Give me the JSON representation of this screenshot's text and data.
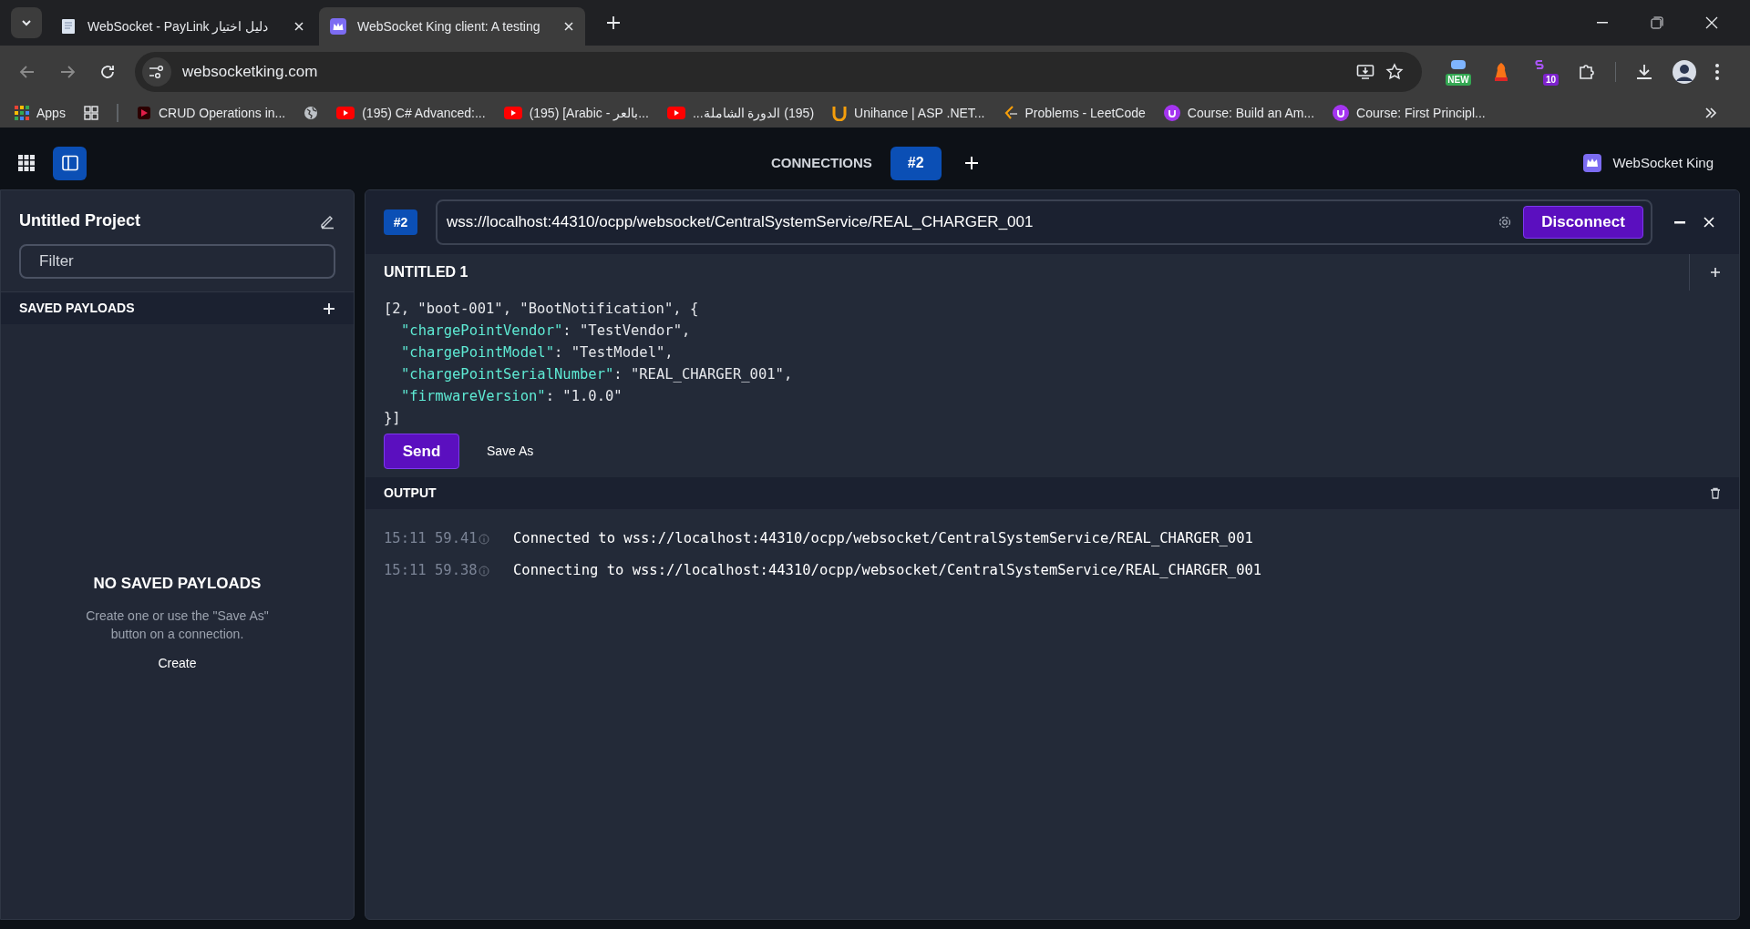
{
  "browser": {
    "tabs": [
      {
        "title": "WebSocket - PayLink دليل اختيار",
        "selected": false,
        "kind": "doc"
      },
      {
        "title": "WebSocket King client: A testing",
        "selected": true,
        "kind": "king"
      }
    ],
    "address": "websocketking.com",
    "bookmarks": [
      {
        "label": "Apps",
        "kind": "apps"
      },
      {
        "label": "CRUD Operations in...",
        "kind": "red"
      },
      {
        "kind": "globe"
      },
      {
        "label": "(195) C# Advanced:...",
        "kind": "youtube"
      },
      {
        "label": "(195) [Arabic - بالعر...",
        "kind": "youtube"
      },
      {
        "label": "(195) الدورة الشاملة...",
        "kind": "youtube"
      },
      {
        "label": "Unihance | ASP .NET...",
        "kind": "unihance"
      },
      {
        "label": "Problems - LeetCode",
        "kind": "leetcode"
      },
      {
        "label": "Course: Build an Am...",
        "kind": "udemy"
      },
      {
        "label": "Course: First Principl...",
        "kind": "udemy"
      }
    ],
    "extension_badges": [
      "NEW",
      "10"
    ]
  },
  "app": {
    "connections_label": "CONNECTIONS",
    "connection_tabs": [
      {
        "label": "#2",
        "selected": true
      }
    ],
    "brand": "WebSocket King"
  },
  "sidebar": {
    "project": "Untitled Project",
    "filter_placeholder": "Filter",
    "section": "SAVED PAYLOADS",
    "empty_title": "NO SAVED PAYLOADS",
    "empty_text": "Create one or use the \"Save As\" button on a connection.",
    "create": "Create"
  },
  "connection": {
    "badge": "#2",
    "url": "wss://localhost:44310/ocpp/websocket/CentralSystemService/REAL_CHARGER_001",
    "action": "Disconnect",
    "payload_title": "UNTITLED 1",
    "payload_lines": [
      {
        "text": "[2, \"boot-001\", \"BootNotification\", {"
      },
      {
        "key": "\"chargePointVendor\"",
        "text": ": \"TestVendor\","
      },
      {
        "key": "\"chargePointModel\"",
        "text": ": \"TestModel\","
      },
      {
        "key": "\"chargePointSerialNumber\"",
        "text": ": \"REAL_CHARGER_001\","
      },
      {
        "key": "\"firmwareVersion\"",
        "text": ": \"1.0.0\""
      },
      {
        "text": "}]"
      }
    ],
    "send": "Send",
    "save_as": "Save As",
    "output_title": "OUTPUT",
    "output": [
      {
        "time": "15:11 59.41",
        "message": "Connected to wss://localhost:44310/ocpp/websocket/CentralSystemService/REAL_CHARGER_001"
      },
      {
        "time": "15:11 59.38",
        "message": "Connecting to wss://localhost:44310/ocpp/websocket/CentralSystemService/REAL_CHARGER_001"
      }
    ]
  }
}
